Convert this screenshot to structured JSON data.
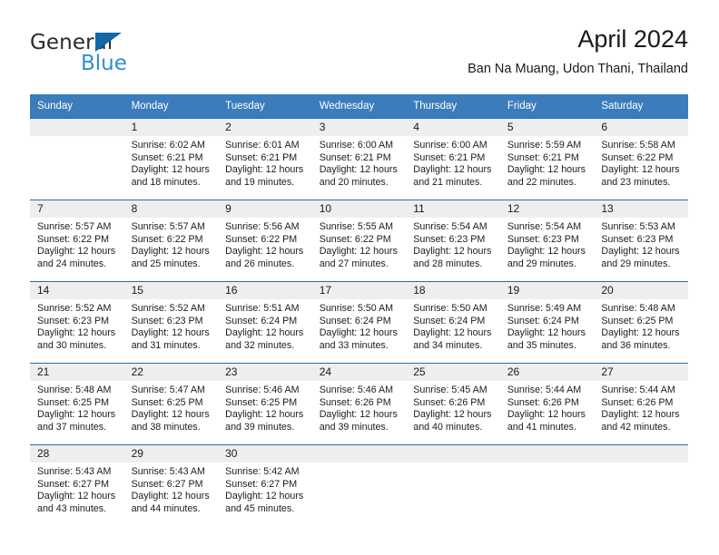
{
  "brand": {
    "name_part1": "General",
    "name_part2": "Blue",
    "triangle_color": "#1267a8",
    "blue_color": "#2f8fd4"
  },
  "header": {
    "title": "April 2024",
    "subtitle": "Ban Na Muang, Udon Thani, Thailand"
  },
  "theme": {
    "header_bg": "#3b7cbd",
    "row_divider": "#2b6ca8",
    "daynum_bg": "#eeeeee"
  },
  "calendar": {
    "weekday_headers": [
      "Sunday",
      "Monday",
      "Tuesday",
      "Wednesday",
      "Thursday",
      "Friday",
      "Saturday"
    ],
    "weeks": [
      [
        {
          "day": "",
          "sunrise": "",
          "sunset": "",
          "daylight_l1": "",
          "daylight_l2": "",
          "empty": true
        },
        {
          "day": "1",
          "sunrise": "Sunrise: 6:02 AM",
          "sunset": "Sunset: 6:21 PM",
          "daylight_l1": "Daylight: 12 hours",
          "daylight_l2": "and 18 minutes."
        },
        {
          "day": "2",
          "sunrise": "Sunrise: 6:01 AM",
          "sunset": "Sunset: 6:21 PM",
          "daylight_l1": "Daylight: 12 hours",
          "daylight_l2": "and 19 minutes."
        },
        {
          "day": "3",
          "sunrise": "Sunrise: 6:00 AM",
          "sunset": "Sunset: 6:21 PM",
          "daylight_l1": "Daylight: 12 hours",
          "daylight_l2": "and 20 minutes."
        },
        {
          "day": "4",
          "sunrise": "Sunrise: 6:00 AM",
          "sunset": "Sunset: 6:21 PM",
          "daylight_l1": "Daylight: 12 hours",
          "daylight_l2": "and 21 minutes."
        },
        {
          "day": "5",
          "sunrise": "Sunrise: 5:59 AM",
          "sunset": "Sunset: 6:21 PM",
          "daylight_l1": "Daylight: 12 hours",
          "daylight_l2": "and 22 minutes."
        },
        {
          "day": "6",
          "sunrise": "Sunrise: 5:58 AM",
          "sunset": "Sunset: 6:22 PM",
          "daylight_l1": "Daylight: 12 hours",
          "daylight_l2": "and 23 minutes."
        }
      ],
      [
        {
          "day": "7",
          "sunrise": "Sunrise: 5:57 AM",
          "sunset": "Sunset: 6:22 PM",
          "daylight_l1": "Daylight: 12 hours",
          "daylight_l2": "and 24 minutes."
        },
        {
          "day": "8",
          "sunrise": "Sunrise: 5:57 AM",
          "sunset": "Sunset: 6:22 PM",
          "daylight_l1": "Daylight: 12 hours",
          "daylight_l2": "and 25 minutes."
        },
        {
          "day": "9",
          "sunrise": "Sunrise: 5:56 AM",
          "sunset": "Sunset: 6:22 PM",
          "daylight_l1": "Daylight: 12 hours",
          "daylight_l2": "and 26 minutes."
        },
        {
          "day": "10",
          "sunrise": "Sunrise: 5:55 AM",
          "sunset": "Sunset: 6:22 PM",
          "daylight_l1": "Daylight: 12 hours",
          "daylight_l2": "and 27 minutes."
        },
        {
          "day": "11",
          "sunrise": "Sunrise: 5:54 AM",
          "sunset": "Sunset: 6:23 PM",
          "daylight_l1": "Daylight: 12 hours",
          "daylight_l2": "and 28 minutes."
        },
        {
          "day": "12",
          "sunrise": "Sunrise: 5:54 AM",
          "sunset": "Sunset: 6:23 PM",
          "daylight_l1": "Daylight: 12 hours",
          "daylight_l2": "and 29 minutes."
        },
        {
          "day": "13",
          "sunrise": "Sunrise: 5:53 AM",
          "sunset": "Sunset: 6:23 PM",
          "daylight_l1": "Daylight: 12 hours",
          "daylight_l2": "and 29 minutes."
        }
      ],
      [
        {
          "day": "14",
          "sunrise": "Sunrise: 5:52 AM",
          "sunset": "Sunset: 6:23 PM",
          "daylight_l1": "Daylight: 12 hours",
          "daylight_l2": "and 30 minutes."
        },
        {
          "day": "15",
          "sunrise": "Sunrise: 5:52 AM",
          "sunset": "Sunset: 6:23 PM",
          "daylight_l1": "Daylight: 12 hours",
          "daylight_l2": "and 31 minutes."
        },
        {
          "day": "16",
          "sunrise": "Sunrise: 5:51 AM",
          "sunset": "Sunset: 6:24 PM",
          "daylight_l1": "Daylight: 12 hours",
          "daylight_l2": "and 32 minutes."
        },
        {
          "day": "17",
          "sunrise": "Sunrise: 5:50 AM",
          "sunset": "Sunset: 6:24 PM",
          "daylight_l1": "Daylight: 12 hours",
          "daylight_l2": "and 33 minutes."
        },
        {
          "day": "18",
          "sunrise": "Sunrise: 5:50 AM",
          "sunset": "Sunset: 6:24 PM",
          "daylight_l1": "Daylight: 12 hours",
          "daylight_l2": "and 34 minutes."
        },
        {
          "day": "19",
          "sunrise": "Sunrise: 5:49 AM",
          "sunset": "Sunset: 6:24 PM",
          "daylight_l1": "Daylight: 12 hours",
          "daylight_l2": "and 35 minutes."
        },
        {
          "day": "20",
          "sunrise": "Sunrise: 5:48 AM",
          "sunset": "Sunset: 6:25 PM",
          "daylight_l1": "Daylight: 12 hours",
          "daylight_l2": "and 36 minutes."
        }
      ],
      [
        {
          "day": "21",
          "sunrise": "Sunrise: 5:48 AM",
          "sunset": "Sunset: 6:25 PM",
          "daylight_l1": "Daylight: 12 hours",
          "daylight_l2": "and 37 minutes."
        },
        {
          "day": "22",
          "sunrise": "Sunrise: 5:47 AM",
          "sunset": "Sunset: 6:25 PM",
          "daylight_l1": "Daylight: 12 hours",
          "daylight_l2": "and 38 minutes."
        },
        {
          "day": "23",
          "sunrise": "Sunrise: 5:46 AM",
          "sunset": "Sunset: 6:25 PM",
          "daylight_l1": "Daylight: 12 hours",
          "daylight_l2": "and 39 minutes."
        },
        {
          "day": "24",
          "sunrise": "Sunrise: 5:46 AM",
          "sunset": "Sunset: 6:26 PM",
          "daylight_l1": "Daylight: 12 hours",
          "daylight_l2": "and 39 minutes."
        },
        {
          "day": "25",
          "sunrise": "Sunrise: 5:45 AM",
          "sunset": "Sunset: 6:26 PM",
          "daylight_l1": "Daylight: 12 hours",
          "daylight_l2": "and 40 minutes."
        },
        {
          "day": "26",
          "sunrise": "Sunrise: 5:44 AM",
          "sunset": "Sunset: 6:26 PM",
          "daylight_l1": "Daylight: 12 hours",
          "daylight_l2": "and 41 minutes."
        },
        {
          "day": "27",
          "sunrise": "Sunrise: 5:44 AM",
          "sunset": "Sunset: 6:26 PM",
          "daylight_l1": "Daylight: 12 hours",
          "daylight_l2": "and 42 minutes."
        }
      ],
      [
        {
          "day": "28",
          "sunrise": "Sunrise: 5:43 AM",
          "sunset": "Sunset: 6:27 PM",
          "daylight_l1": "Daylight: 12 hours",
          "daylight_l2": "and 43 minutes."
        },
        {
          "day": "29",
          "sunrise": "Sunrise: 5:43 AM",
          "sunset": "Sunset: 6:27 PM",
          "daylight_l1": "Daylight: 12 hours",
          "daylight_l2": "and 44 minutes."
        },
        {
          "day": "30",
          "sunrise": "Sunrise: 5:42 AM",
          "sunset": "Sunset: 6:27 PM",
          "daylight_l1": "Daylight: 12 hours",
          "daylight_l2": "and 45 minutes."
        },
        {
          "day": "",
          "sunrise": "",
          "sunset": "",
          "daylight_l1": "",
          "daylight_l2": "",
          "empty": true
        },
        {
          "day": "",
          "sunrise": "",
          "sunset": "",
          "daylight_l1": "",
          "daylight_l2": "",
          "empty": true
        },
        {
          "day": "",
          "sunrise": "",
          "sunset": "",
          "daylight_l1": "",
          "daylight_l2": "",
          "empty": true
        },
        {
          "day": "",
          "sunrise": "",
          "sunset": "",
          "daylight_l1": "",
          "daylight_l2": "",
          "empty": true
        }
      ]
    ]
  }
}
